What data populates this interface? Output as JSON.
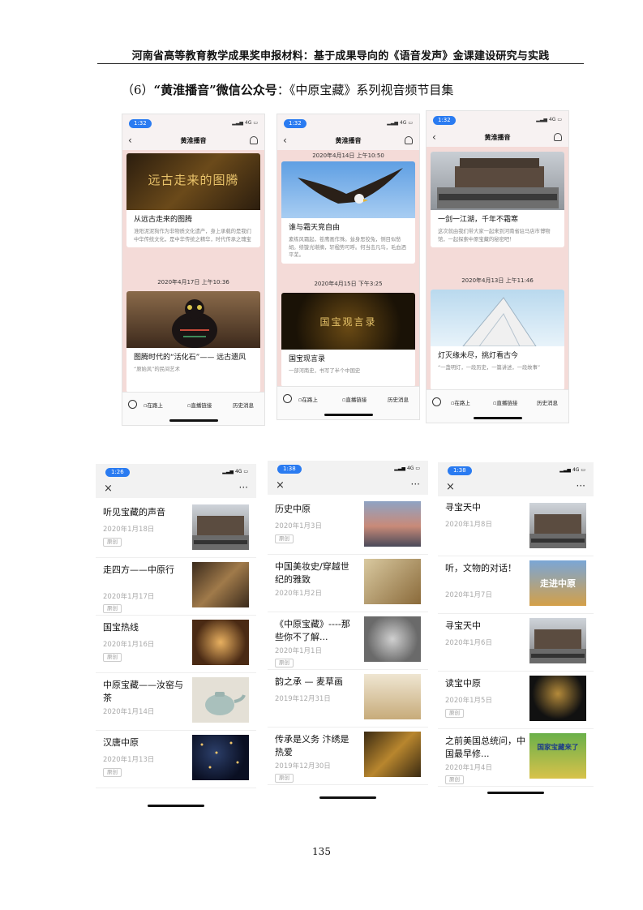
{
  "header": {
    "text": "河南省高等教育教学成果奖申报材料：基于成果导向的《语音发声》金课建设研究与实践"
  },
  "section": {
    "number": "（6）",
    "name": "“黄淮播音”微信公众号",
    "rest": "：《中原宝藏》系列视音频节目集"
  },
  "page_number": "135",
  "top_phones": [
    {
      "time": "1:32",
      "signal": "4G",
      "nav_title": "黄淮播音",
      "card1": {
        "img_text": "远古走来的图腾",
        "title": "从远古走来的图腾",
        "desc": "淮阳泥泥狗作为非物质文化遗产，身上承载的是我们中华传统文化，是中华传统之精华，时代传承之瑰宝"
      },
      "timestamp": "2020年4月17日 上午10:36",
      "card2": {
        "title": "图腾时代的“活化石”—— 远古遗风",
        "desc": "“原始风”的民间艺术"
      },
      "menu": [
        "在路上",
        "直播链接",
        "历史消息"
      ]
    },
    {
      "time": "1:32",
      "signal": "4G",
      "nav_title": "黄淮播音",
      "timestamp1": "2020年4月14日 上午10:50",
      "card1": {
        "title": "谁与霜天竞自由",
        "desc": "素练风霜起，苍鹰画作殊。耸身思狡兔，侧目似愁胡。绦镟光堪摘，轩楹势可呼。何当击凡鸟，毛血洒平芜。"
      },
      "timestamp2": "2020年4月15日 下午3:25",
      "card2": {
        "img_text": "国宝观言录",
        "title": "国宝现言录",
        "desc": "一部河南史，书写了半个中国史"
      },
      "menu": [
        "在路上",
        "直播链接",
        "历史消息"
      ]
    },
    {
      "time": "1:32",
      "signal": "4G",
      "nav_title": "黄淮播音",
      "card1": {
        "title": "一剑一江湖，千年不霜寒",
        "desc": "这次就由我们带大家一起来到河南省驻马店市博物馆，一起探索中原宝藏的秘密吧！"
      },
      "timestamp": "2020年4月13日 上午11:46",
      "card2": {
        "title": "灯灭缘未尽，挑灯看古今",
        "desc": "“一盏明灯，一段历史，一篇讲述，一段故事”"
      },
      "menu": [
        "在路上",
        "直播链接",
        "历史消息"
      ]
    }
  ],
  "list_phones": [
    {
      "time": "1:26",
      "signal": "4G",
      "items": [
        {
          "title": "听见宝藏的声音",
          "date": "2020年1月18日",
          "tag": "原创"
        },
        {
          "title": "走四方——中原行",
          "date": "2020年1月17日",
          "tag": "原创"
        },
        {
          "title": "国宝热线",
          "date": "2020年1月16日",
          "tag": "原创"
        },
        {
          "title": "中原宝藏——汝窑与茶",
          "date": "2020年1月14日",
          "tag": ""
        },
        {
          "title": "汉唐中原",
          "date": "2020年1月13日",
          "tag": "原创"
        }
      ]
    },
    {
      "time": "1:38",
      "signal": "4G",
      "items": [
        {
          "title": "历史中原",
          "date": "2020年1月3日",
          "tag": "原创"
        },
        {
          "title": "中国美妆史/穿越世纪的雅致",
          "date": "2020年1月2日",
          "tag": ""
        },
        {
          "title": "《中原宝藏》----那些你不了解...",
          "date": "2020年1月1日",
          "tag": "原创"
        },
        {
          "title": "韵之承 — 麦草画",
          "date": "2019年12月31日",
          "tag": ""
        },
        {
          "title": "传承是义务 汴绣是热爱",
          "date": "2019年12月30日",
          "tag": "原创"
        }
      ]
    },
    {
      "time": "1:38",
      "signal": "4G",
      "items": [
        {
          "title": "寻宝天中",
          "date": "2020年1月8日",
          "tag": ""
        },
        {
          "title": "听，文物的对话！",
          "date": "2020年1月7日",
          "tag": ""
        },
        {
          "title": "寻宝天中",
          "date": "2020年1月6日",
          "tag": ""
        },
        {
          "title": "读宝中原",
          "date": "2020年1月5日",
          "tag": "原创"
        },
        {
          "title": "之前美国总统问，中国最早修...",
          "date": "2020年1月4日",
          "tag": "原创"
        }
      ]
    }
  ],
  "thumb_texts": {
    "walk": "走进中原",
    "q": "国家宝藏来了"
  },
  "colors": {
    "feed_bg": "#f4dbd8",
    "ios_blue": "#2a7bf1"
  }
}
